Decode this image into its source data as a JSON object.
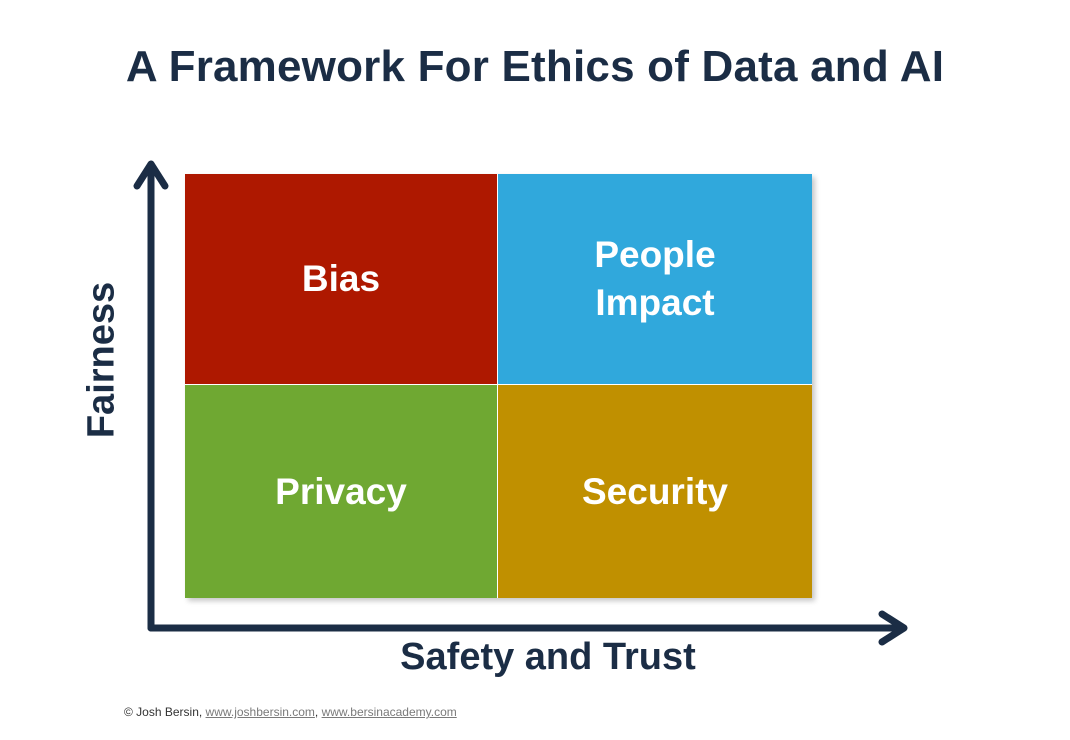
{
  "title": "A Framework For Ethics of Data and AI",
  "axes": {
    "y_label": "Fairness",
    "x_label": "Safety and Trust",
    "color": "#1b2d45"
  },
  "quadrants": [
    {
      "label": "Bias",
      "color": "#ae1800"
    },
    {
      "label": "People\nImpact",
      "color": "#30a8dc"
    },
    {
      "label": "Privacy",
      "color": "#6fa832"
    },
    {
      "label": "Security",
      "color": "#c09000"
    }
  ],
  "footer": {
    "copyright": "© Josh Bersin, ",
    "link1": "www.joshbersin.com",
    "separator": ", ",
    "link2": "www.bersinacademy.com"
  }
}
